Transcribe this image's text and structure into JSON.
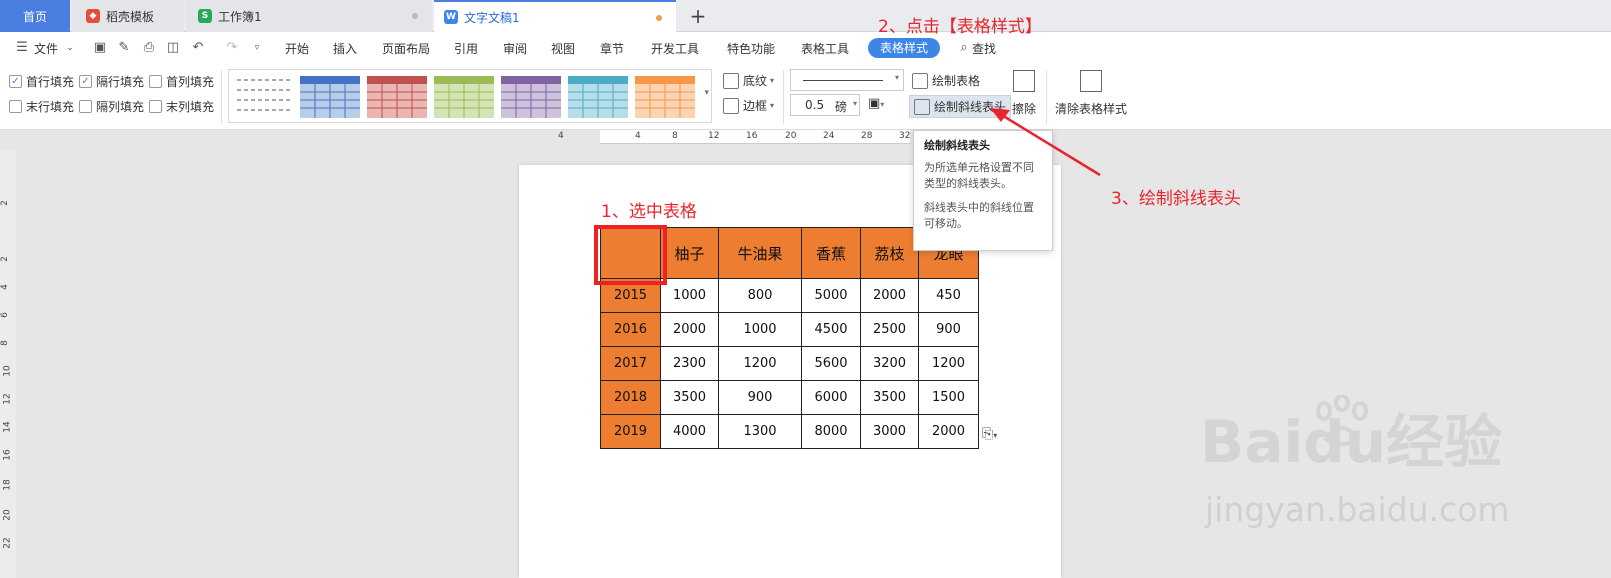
{
  "tabs": {
    "home": "首页",
    "docer": "稻壳模板",
    "sheet": "工作簿1",
    "doc": "文字文稿1",
    "add": "+"
  },
  "menu": {
    "file": "文件",
    "items": [
      "开始",
      "插入",
      "页面布局",
      "引用",
      "审阅",
      "视图",
      "章节",
      "开发工具",
      "特色功能",
      "表格工具"
    ],
    "active": "表格样式",
    "search": "查找"
  },
  "ribbon": {
    "checkboxes": [
      {
        "label": "首行填充",
        "checked": true
      },
      {
        "label": "隔行填充",
        "checked": true
      },
      {
        "label": "首列填充",
        "checked": false
      },
      {
        "label": "末行填充",
        "checked": false
      },
      {
        "label": "隔列填充",
        "checked": false
      },
      {
        "label": "末列填充",
        "checked": false
      }
    ],
    "shading": "底纹",
    "border": "边框",
    "line_width": "0.5",
    "line_unit": "磅",
    "draw_table": "绘制表格",
    "draw_diagonal": "绘制斜线表头",
    "erase": "擦除",
    "clear_style": "清除表格样式"
  },
  "ruler": {
    "h_numbers": [
      "4",
      "4",
      "8",
      "12",
      "16",
      "20",
      "24",
      "28",
      "32"
    ],
    "v_numbers": [
      "2",
      "2",
      "4",
      "6",
      "8",
      "10",
      "12",
      "14",
      "16",
      "18",
      "20",
      "22"
    ]
  },
  "table": {
    "headers": [
      "",
      "柚子",
      "牛油果",
      "香蕉",
      "荔枝",
      "龙眼"
    ],
    "rows": [
      [
        "2015",
        "1000",
        "800",
        "5000",
        "2000",
        "450"
      ],
      [
        "2016",
        "2000",
        "1000",
        "4500",
        "2500",
        "900"
      ],
      [
        "2017",
        "2300",
        "1200",
        "5600",
        "3200",
        "1200"
      ],
      [
        "2018",
        "3500",
        "900",
        "6000",
        "3500",
        "1500"
      ],
      [
        "2019",
        "4000",
        "1300",
        "8000",
        "3000",
        "2000"
      ]
    ]
  },
  "tooltip": {
    "title": "绘制斜线表头",
    "p1": "为所选单元格设置不同类型的斜线表头。",
    "p2": "斜线表头中的斜线位置可移动。"
  },
  "annotations": {
    "step1": "1、选中表格",
    "step2": "2、点击【表格样式】",
    "step3": "3、绘制斜线表头"
  },
  "watermark": {
    "brand": "Bai",
    "brand2": "du经验",
    "url": "jingyan.baidu.com"
  },
  "colors": {
    "accent": "#3d86e8",
    "table_fill": "#ed7d31",
    "annotation": "#e8252f"
  }
}
